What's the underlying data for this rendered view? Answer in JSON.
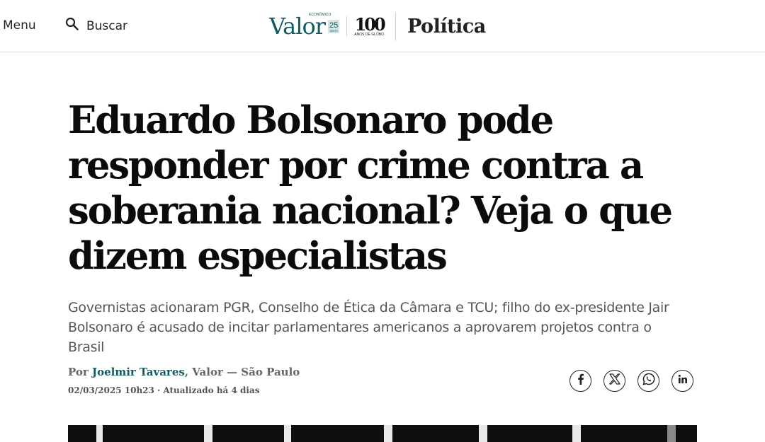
{
  "header": {
    "menu_label": "Menu",
    "search_label": "Buscar",
    "search_icon": "search-icon",
    "logo": {
      "valor_text": "Valor",
      "valor_sup": "ECONÔMICO",
      "anos25": "25",
      "anos25_sub": "ANOS",
      "globo_num": "100",
      "globo_sub": "ANOS DE GLOBO"
    },
    "section_title": "Política"
  },
  "article": {
    "headline": "Eduardo Bolsonaro pode responder por crime contra a soberania nacional? Veja o que dizem especialistas",
    "subtitle": "Governistas acionaram PGR, Conselho de Ética da Câmara e TCU; filho do ex-presidente Jair Bolsonaro é acusado de incitar parlamentares americanos a aprovarem projetos contra o Brasil",
    "byline_prefix": "Por ",
    "author": "Joelmir Tavares",
    "byline_suffix": ", Valor — São Paulo",
    "dateline": "02/03/2025 10h23 · Atualizado há 4 dias"
  },
  "share": [
    {
      "network": "facebook",
      "icon": "facebook-icon"
    },
    {
      "network": "x",
      "icon": "x-icon"
    },
    {
      "network": "whatsapp",
      "icon": "whatsapp-icon"
    },
    {
      "network": "linkedin",
      "icon": "linkedin-icon"
    }
  ],
  "colors": {
    "brand_teal": "#0f5a63",
    "headline": "#0b0b0b",
    "subtitle": "#555555"
  }
}
